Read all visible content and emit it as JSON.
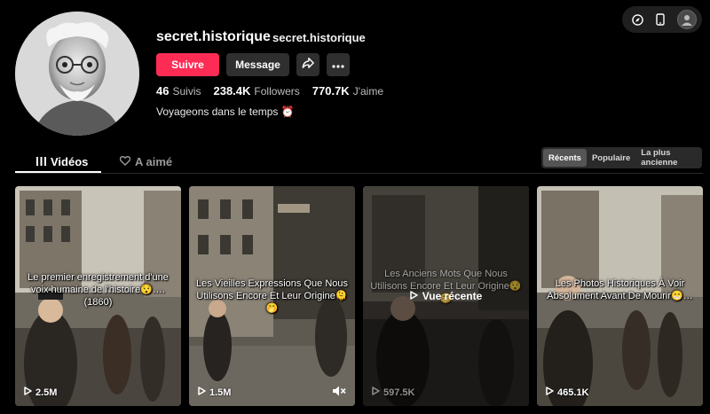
{
  "profile": {
    "username": "secret.historique",
    "nickname": "secret.historique",
    "follow_label": "Suivre",
    "message_label": "Message",
    "stats": [
      {
        "num": "46",
        "label": "Suivis"
      },
      {
        "num": "238.4K",
        "label": "Followers"
      },
      {
        "num": "770.7K",
        "label": "J'aime"
      }
    ],
    "bio": "Voyageons dans le temps ⏰"
  },
  "tabs": {
    "videos": "Vidéos",
    "liked": "A aimé"
  },
  "sort": {
    "options": [
      "Récents",
      "Populaire",
      "La plus ancienne"
    ],
    "selected": "Récents"
  },
  "videos": [
    {
      "caption": "Le premier enregistrement d'une voix humaine de l'histoire😯…. (1860)",
      "views": "2.5M"
    },
    {
      "caption": "Les Vieilles Expressions Que Nous Utilisons Encore Et Leur Origine🫠🤭",
      "views": "1.5M"
    },
    {
      "caption": "Les Anciens Mots Que Nous Utilisons Encore Et Leur Origine😯🤭",
      "views": "597.5K",
      "overlay": "Vue récente"
    },
    {
      "caption": "Les Photos Historiques À Voir Absolument Avant De Mourir😁…",
      "views": "465.1K"
    }
  ],
  "colors": {
    "accent": "#fe2c55",
    "background": "#000000",
    "button": "#2f2f2f"
  },
  "icons": [
    "share-icon",
    "more-icon",
    "compass-icon",
    "phone-icon",
    "play-icon",
    "mute-icon",
    "videos-grid-icon",
    "liked-heart-icon"
  ]
}
